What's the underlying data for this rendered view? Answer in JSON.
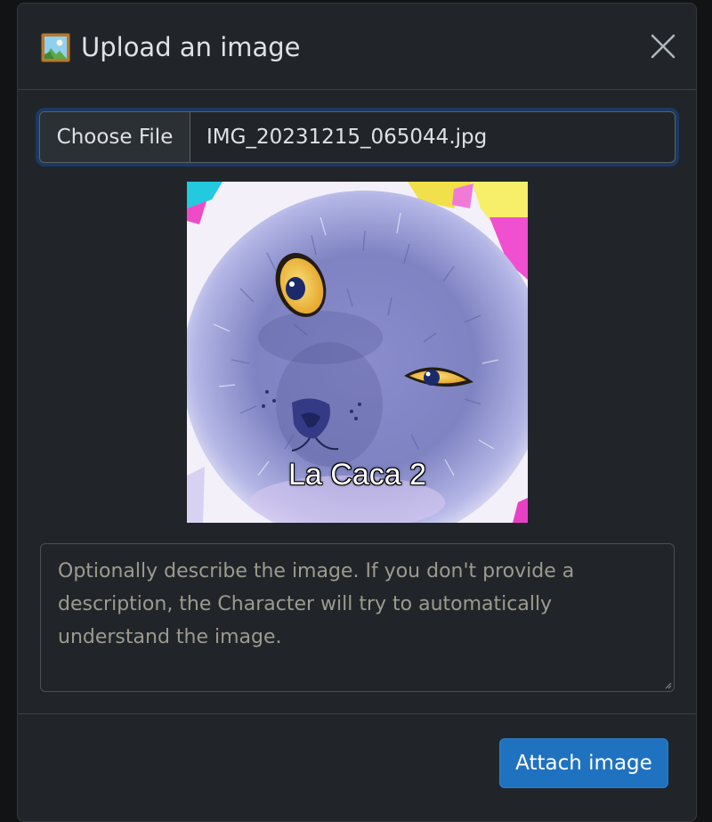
{
  "modal": {
    "title": "Upload an image",
    "title_icon": "framed-picture-icon",
    "close_icon": "close-icon"
  },
  "file_input": {
    "button_label": "Choose File",
    "file_name": "IMG_20231215_065044.jpg"
  },
  "preview": {
    "caption": "La Caca 2"
  },
  "description": {
    "placeholder": "Optionally describe the image. If you don't provide a description, the Character will try to automatically understand the image.",
    "value": ""
  },
  "footer": {
    "attach_label": "Attach image"
  },
  "colors": {
    "modal_bg": "#212529",
    "primary_button": "#1f72c0",
    "focus_ring": "#0d6efd"
  }
}
